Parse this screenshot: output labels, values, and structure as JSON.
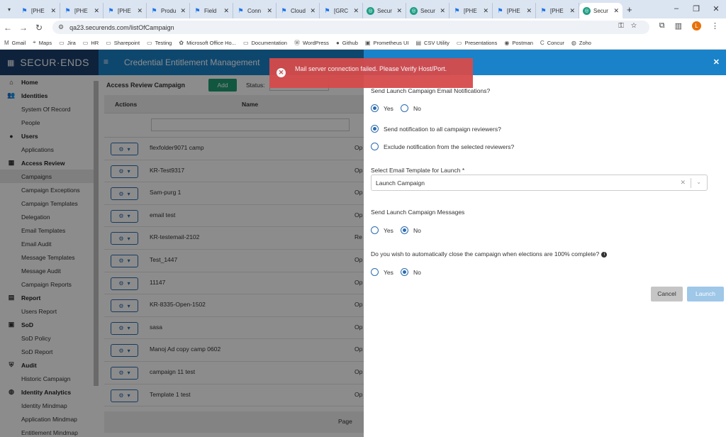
{
  "browser": {
    "tabs": [
      {
        "title": "[PHE",
        "icon": "phe-icon"
      },
      {
        "title": "[PHE",
        "icon": "phe-icon"
      },
      {
        "title": "[PHE",
        "icon": "phe-icon"
      },
      {
        "title": "Produ",
        "icon": "phe-icon"
      },
      {
        "title": "Field",
        "icon": "phe-icon"
      },
      {
        "title": "Conn",
        "icon": "phe-icon"
      },
      {
        "title": "Cloud",
        "icon": "phe-icon"
      },
      {
        "title": "[GRC",
        "icon": "phe-icon"
      },
      {
        "title": "Secur",
        "icon": "securends-icon"
      },
      {
        "title": "Secur",
        "icon": "securends-icon"
      },
      {
        "title": "[PHE",
        "icon": "phe-icon"
      },
      {
        "title": "[PHE",
        "icon": "phe-icon"
      },
      {
        "title": "[PHE",
        "icon": "phe-icon"
      },
      {
        "title": "Secur",
        "icon": "securends-icon"
      }
    ],
    "active_tab_index": 13,
    "url": "qa23.securends.com/listOfCampaign",
    "profile_initial": "L",
    "bookmarks": [
      {
        "label": "Gmail",
        "icon": "gmail-icon"
      },
      {
        "label": "Maps",
        "icon": "maps-icon"
      },
      {
        "label": "Jira",
        "icon": "folder-icon"
      },
      {
        "label": "HR",
        "icon": "folder-icon"
      },
      {
        "label": "Sharepoint",
        "icon": "folder-icon"
      },
      {
        "label": "Testing",
        "icon": "folder-icon"
      },
      {
        "label": "Microsoft Office Ho...",
        "icon": "office-icon"
      },
      {
        "label": "Documentation",
        "icon": "folder-icon"
      },
      {
        "label": "WordPress",
        "icon": "wordpress-icon"
      },
      {
        "label": "Github",
        "icon": "github-icon"
      },
      {
        "label": "Prometheus UI",
        "icon": "prometheus-icon"
      },
      {
        "label": "CSV Utility",
        "icon": "csv-icon"
      },
      {
        "label": "Presentations",
        "icon": "folder-icon"
      },
      {
        "label": "Postman",
        "icon": "postman-icon"
      },
      {
        "label": "Concur",
        "icon": "concur-icon"
      },
      {
        "label": "Zoho",
        "icon": "zoho-icon"
      }
    ]
  },
  "app": {
    "logo": "SECUR·ENDS",
    "title": "Credential Entitlement Management"
  },
  "sidebar": {
    "items": [
      {
        "label": "Home",
        "type": "section",
        "icon": "home-icon"
      },
      {
        "label": "Identities",
        "type": "section",
        "icon": "users-icon"
      },
      {
        "label": "System Of Record",
        "type": "item"
      },
      {
        "label": "People",
        "type": "item"
      },
      {
        "label": "Users",
        "type": "section",
        "icon": "user-icon"
      },
      {
        "label": "Applications",
        "type": "item"
      },
      {
        "label": "Access Review",
        "type": "section",
        "icon": "grid-icon"
      },
      {
        "label": "Campaigns",
        "type": "item",
        "selected": true
      },
      {
        "label": "Campaign Exceptions",
        "type": "item"
      },
      {
        "label": "Campaign Templates",
        "type": "item"
      },
      {
        "label": "Delegation",
        "type": "item"
      },
      {
        "label": "Email Templates",
        "type": "item"
      },
      {
        "label": "Email Audit",
        "type": "item"
      },
      {
        "label": "Message Templates",
        "type": "item"
      },
      {
        "label": "Message Audit",
        "type": "item"
      },
      {
        "label": "Campaign Reports",
        "type": "item"
      },
      {
        "label": "Report",
        "type": "section",
        "icon": "report-icon"
      },
      {
        "label": "Users Report",
        "type": "item"
      },
      {
        "label": "SoD",
        "type": "section",
        "icon": "sod-icon"
      },
      {
        "label": "SoD Policy",
        "type": "item"
      },
      {
        "label": "SoD Report",
        "type": "item"
      },
      {
        "label": "Audit",
        "type": "section",
        "icon": "shield-icon"
      },
      {
        "label": "Historic Campaign",
        "type": "item"
      },
      {
        "label": "Identity Analytics",
        "type": "section",
        "icon": "analytics-icon"
      },
      {
        "label": "Identity Mindmap",
        "type": "item"
      },
      {
        "label": "Application Mindmap",
        "type": "item"
      },
      {
        "label": "Entitlement Mindmap",
        "type": "item"
      }
    ]
  },
  "campaign_list": {
    "page_title": "Access Review Campaign",
    "add_label": "Add",
    "status_label": "Status:",
    "columns": {
      "actions": "Actions",
      "name": "Name"
    },
    "rows": [
      {
        "name": "flexfolder9071 camp",
        "status": "Op"
      },
      {
        "name": "KR-Test9317",
        "status": "Op"
      },
      {
        "name": "Sam-purg 1",
        "status": "Op"
      },
      {
        "name": "email test",
        "status": "Op"
      },
      {
        "name": "KR-testemail-2102",
        "status": "Re"
      },
      {
        "name": "Test_1447",
        "status": "Op"
      },
      {
        "name": "11147",
        "status": "Op"
      },
      {
        "name": "KR-8335-Open-1502",
        "status": "Op"
      },
      {
        "name": "sasa",
        "status": "Op"
      },
      {
        "name": "Manoj Ad copy camp 0602",
        "status": "Op"
      },
      {
        "name": "campaign 11 test",
        "status": "Op"
      },
      {
        "name": "Template 1 test",
        "status": "Op"
      }
    ],
    "pager_label": "Page"
  },
  "launch_panel": {
    "q_email_notifications": "Send Launch Campaign Email Notifications?",
    "email_notifications": {
      "yes": "Yes",
      "no": "No",
      "selected": "yes"
    },
    "opt_all_reviewers": "Send notification to all campaign reviewers?",
    "opt_exclude_reviewers": "Exclude notification from the selected reviewers?",
    "notification_target_selected": "all",
    "template_label": "Select Email Template for Launch *",
    "template_value": "Launch Campaign",
    "q_messages": "Send Launch Campaign Messages",
    "messages": {
      "yes": "Yes",
      "no": "No",
      "selected": "no"
    },
    "q_auto_close": "Do you wish to automatically close the campaign when elections are 100% complete?",
    "auto_close": {
      "yes": "Yes",
      "no": "No",
      "selected": "no"
    },
    "cancel_label": "Cancel",
    "launch_label": "Launch"
  },
  "toast": {
    "message": "Mail server connection failed. Please Verify Host/Port.",
    "color": "#d64b4b"
  },
  "colors": {
    "topbar": "#1a82c9",
    "logo_bg": "#1b3f6e",
    "add_button": "#1f9e75",
    "radio": "#2b6cb0"
  }
}
